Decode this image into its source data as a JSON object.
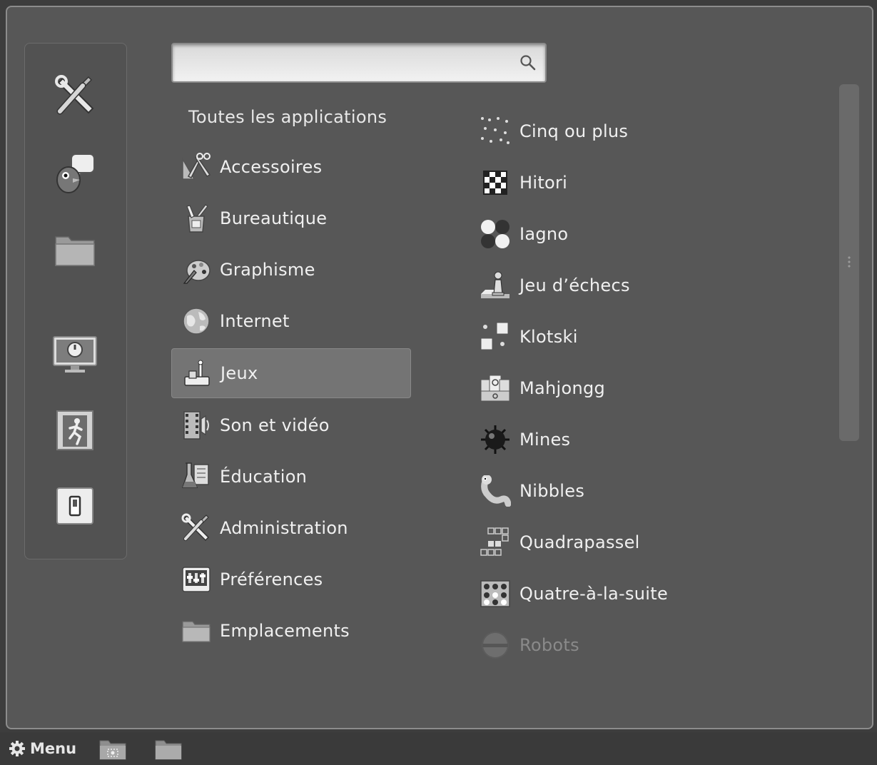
{
  "search": {
    "value": "",
    "placeholder": ""
  },
  "categories_header": "Toutes les applications",
  "categories": [
    {
      "label": "Accessoires",
      "icon": "accessories-icon"
    },
    {
      "label": "Bureautique",
      "icon": "office-icon"
    },
    {
      "label": "Graphisme",
      "icon": "graphics-icon"
    },
    {
      "label": "Internet",
      "icon": "globe-icon"
    },
    {
      "label": "Jeux",
      "icon": "games-icon",
      "selected": true
    },
    {
      "label": "Son et vidéo",
      "icon": "multimedia-icon"
    },
    {
      "label": "Éducation",
      "icon": "education-icon"
    },
    {
      "label": "Administration",
      "icon": "tools-icon"
    },
    {
      "label": "Préférences",
      "icon": "preferences-icon"
    },
    {
      "label": "Emplacements",
      "icon": "folder-icon"
    }
  ],
  "apps": [
    {
      "label": "Cinq ou plus",
      "icon": "five-or-more-icon"
    },
    {
      "label": "Hitori",
      "icon": "hitori-icon"
    },
    {
      "label": "Iagno",
      "icon": "iagno-icon"
    },
    {
      "label": "Jeu d’échecs",
      "icon": "chess-icon"
    },
    {
      "label": "Klotski",
      "icon": "klotski-icon"
    },
    {
      "label": "Mahjongg",
      "icon": "mahjongg-icon"
    },
    {
      "label": "Mines",
      "icon": "mines-icon"
    },
    {
      "label": "Nibbles",
      "icon": "nibbles-icon"
    },
    {
      "label": "Quadrapassel",
      "icon": "quadrapassel-icon"
    },
    {
      "label": "Quatre-à-la-suite",
      "icon": "four-in-a-row-icon"
    },
    {
      "label": "Robots",
      "icon": "robots-icon",
      "faded": true
    }
  ],
  "favorites": [
    {
      "name": "system-settings",
      "icon": "tools-icon"
    },
    {
      "name": "pidgin",
      "icon": "chat-bird-icon"
    },
    {
      "name": "file-manager",
      "icon": "folder-icon"
    },
    {
      "name": "lock-screen",
      "icon": "monitor-lock-icon"
    },
    {
      "name": "logout",
      "icon": "exit-door-icon"
    },
    {
      "name": "shutdown",
      "icon": "power-switch-icon"
    }
  ],
  "taskbar": {
    "menu_label": "Menu",
    "launchers": [
      "screenshot-icon",
      "folder-icon"
    ]
  },
  "colors": {
    "window_bg": "#575757",
    "selected_bg": "#747474",
    "text": "#f0f0f0",
    "faded_text": "#8a8a8a",
    "taskbar_bg": "#3a3a3a"
  }
}
